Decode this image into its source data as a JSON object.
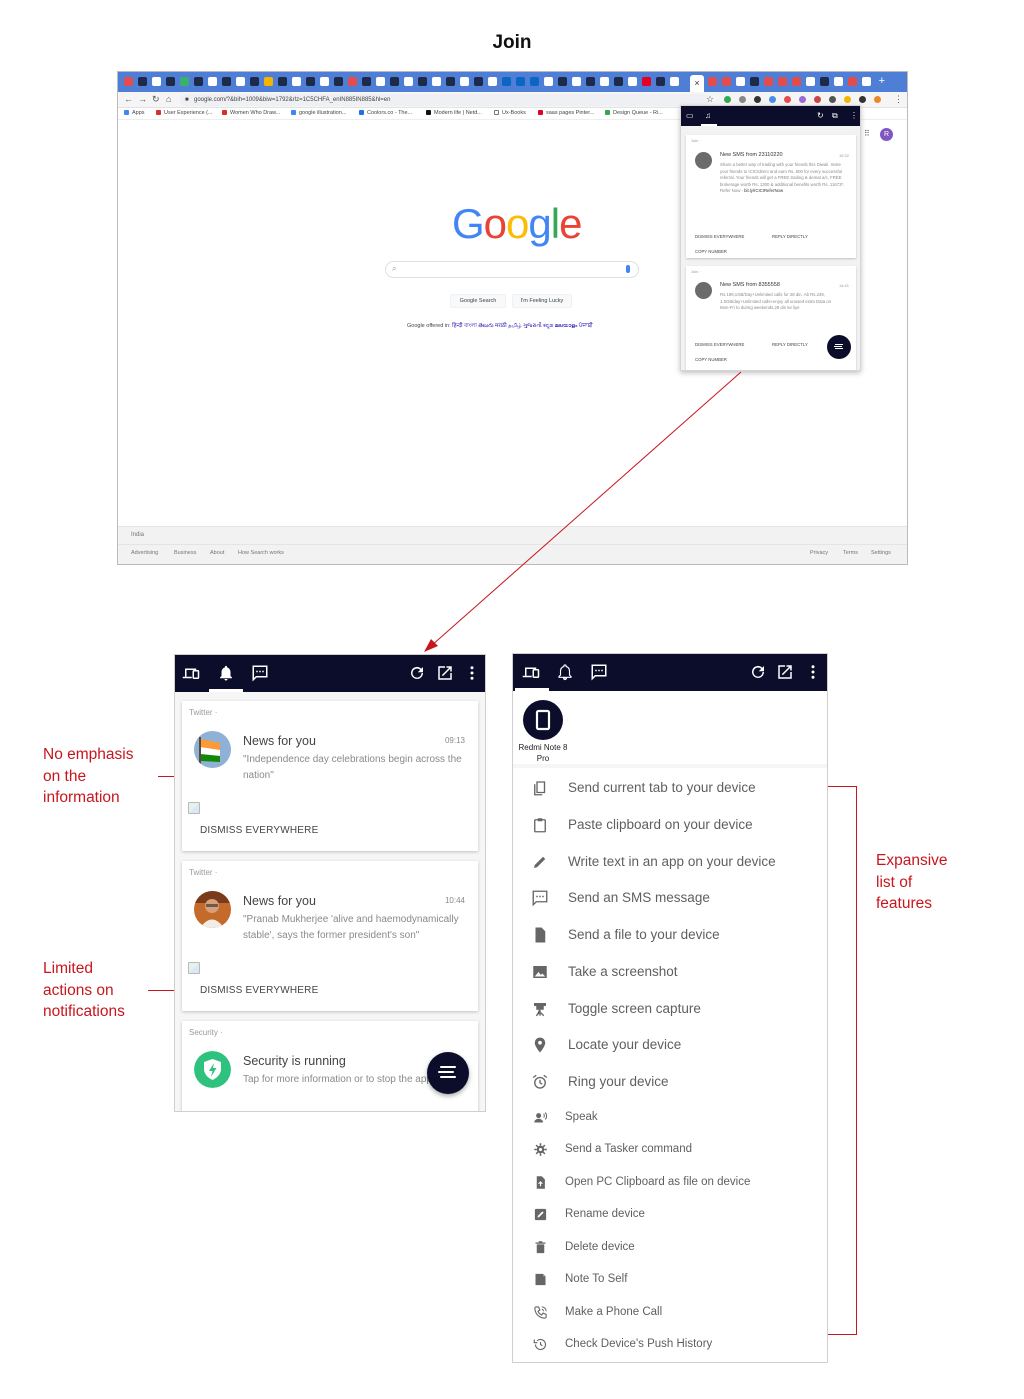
{
  "title": "Join",
  "browser": {
    "url": "google.com/?&bih=1009&biw=1792&rlz=1C5CHFA_enIN885IN885&hl=en",
    "bookmarks": [
      "Apps",
      "User Experience (...",
      "Women Who Draw...",
      "google illustration...",
      "Coolors.co - The...",
      "Modern life | Netd...",
      "Ux-Books",
      "saas pages Pinter...",
      "Design Queue - Ri..."
    ],
    "google": {
      "logo": [
        "G",
        "o",
        "o",
        "g",
        "l",
        "e"
      ],
      "buttons": [
        "Google Search",
        "I'm Feeling Lucky"
      ],
      "offered_label": "Google offered in:",
      "languages": "हिन्दी  বাংলা  తెలుగు  मराठी  தமிழ்  ગુજરાતી  ಕನ್ನಡ  മലയാളം  ਪੰਜਾਬੀ",
      "country": "India",
      "footer_left": [
        "Advertising",
        "Business",
        "About",
        "How Search works"
      ],
      "footer_right": [
        "Privacy",
        "Terms",
        "Settings"
      ],
      "avatar": "R"
    },
    "popup": {
      "cards": [
        {
          "app": "Join  ·",
          "title": "New SMS from 23110220",
          "time": "15:32",
          "body": "Share a better way of trading with your friends this Diwali. Invite your friends to ICICIdirect and earn Rs. 500 for every successful referral. Your friends will get a FREE trading & demat a/c, FREE brokerage worth Rs. 1300 & additional benefits worth Rs. 11673*. Refer Now -",
          "link": "bit.ly/ICICIReferNow",
          "actions": [
            "DISMISS EVERYWHERE",
            "REPLY DIRECTLY",
            "COPY NUMBER"
          ]
        },
        {
          "app": "Join  ·",
          "title": "New SMS from 8355558",
          "time": "14:41",
          "body": "Rs.199,1GB/Day+Unlimited calls for 28 din. Ab Rs.249, 1.5GB/day+Unlimited calls+enjoy all unused extra Data on Mon-Fri to during weekends,28 din ke liye",
          "actions": [
            "DISMISS EVERYWHERE",
            "REPLY DIRECTLY",
            "COPY NUMBER"
          ]
        }
      ]
    }
  },
  "annotations": {
    "no_emphasis": [
      "No emphasis",
      "on the",
      "information"
    ],
    "limited_actions": [
      "Limited",
      "actions on",
      "notifications"
    ],
    "expansive_list": [
      "Expansive",
      "list of",
      "features"
    ]
  },
  "notifications_panel": {
    "cards": [
      {
        "app": "Twitter  ·",
        "title": "News for you",
        "time": "09:13",
        "text": "\"Independence day celebrations begin across the nation\"",
        "action": "DISMISS EVERYWHERE"
      },
      {
        "app": "Twitter  ·",
        "title": "News for you",
        "time": "10:44",
        "text": "\"Pranab Mukherjee 'alive and haemodynamically stable', says the former president's son\"",
        "action": "DISMISS EVERYWHERE"
      },
      {
        "app": "Security  ·",
        "title": "Security is running",
        "text": "Tap for more information or to stop the app."
      }
    ]
  },
  "devices_panel": {
    "device_name_line1": "Redmi Note 8",
    "device_name_line2": "Pro",
    "features": [
      {
        "icon": "copy-icon",
        "label": "Send current tab to your device"
      },
      {
        "icon": "clipboard-icon",
        "label": "Paste clipboard on your device"
      },
      {
        "icon": "pencil-icon",
        "label": "Write text in an app on your device"
      },
      {
        "icon": "sms-icon",
        "label": "Send an SMS message"
      },
      {
        "icon": "file-icon",
        "label": "Send a file to your device"
      },
      {
        "icon": "image-icon",
        "label": "Take a screenshot"
      },
      {
        "icon": "projector-icon",
        "label": "Toggle screen capture"
      },
      {
        "icon": "location-pin-icon",
        "label": "Locate your device"
      },
      {
        "icon": "alarm-icon",
        "label": "Ring your device"
      },
      {
        "icon": "speak-icon",
        "label": "Speak"
      },
      {
        "icon": "tasker-icon",
        "label": "Send a Tasker command"
      },
      {
        "icon": "file-upload-icon",
        "label": "Open PC Clipboard as file on device"
      },
      {
        "icon": "rename-icon",
        "label": "Rename device"
      },
      {
        "icon": "trash-icon",
        "label": "Delete device"
      },
      {
        "icon": "note-icon",
        "label": "Note To Self"
      },
      {
        "icon": "phone-call-icon",
        "label": "Make a Phone Call"
      },
      {
        "icon": "history-icon",
        "label": "Check Device's Push History"
      }
    ]
  },
  "colors": {
    "appbar": "#0b0d2b",
    "annotation": "#c8161e",
    "browser_tabbar": "#4f7ed6"
  }
}
